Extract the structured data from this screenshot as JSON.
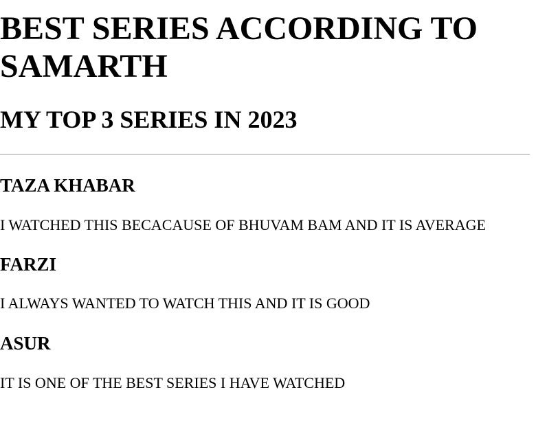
{
  "header": {
    "title": "BEST SERIES ACCORDING TO SAMARTH",
    "subtitle": "MY TOP 3 SERIES IN 2023"
  },
  "series": [
    {
      "name": "TAZA KHABAR",
      "comment": "I WATCHED THIS BECACAUSE OF BHUVAM BAM AND IT IS AVERAGE"
    },
    {
      "name": "FARZI",
      "comment": "I ALWAYS WANTED TO WATCH THIS AND IT IS GOOD"
    },
    {
      "name": "ASUR",
      "comment": "IT IS ONE OF THE BEST SERIES I HAVE WATCHED"
    }
  ]
}
